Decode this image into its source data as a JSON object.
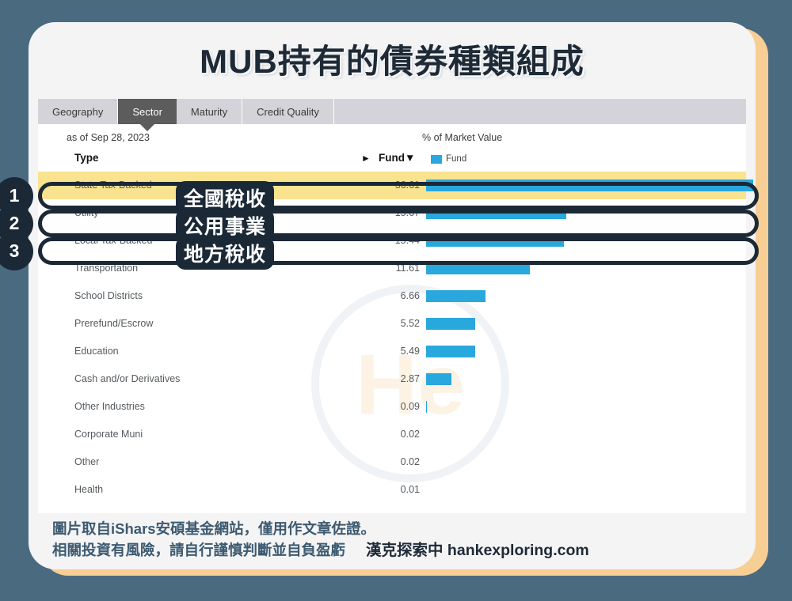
{
  "title": "MUB持有的債券種類組成",
  "colors": {
    "page_background": "#4a6a80",
    "card_background": "#f4f4f5",
    "accent_stripe": "#f7ce93",
    "bar": "#29a8dd",
    "highlight_row": "#fae38f",
    "annotation": "#1b2836",
    "active_tab": "#5c5c5c"
  },
  "tabs": [
    {
      "label": "Geography",
      "active": false
    },
    {
      "label": "Sector",
      "active": true
    },
    {
      "label": "Maturity",
      "active": false
    },
    {
      "label": "Credit Quality",
      "active": false
    }
  ],
  "meta": {
    "as_of": "as of Sep 28, 2023",
    "market_value_label": "% of Market Value"
  },
  "header": {
    "type_label": "Type",
    "expand_caret": "►",
    "fund_label": "Fund",
    "fund_sort_caret": "▼",
    "legend_label": "Fund"
  },
  "chart_data": {
    "type": "bar",
    "title": "MUB持有的債券種類組成",
    "xlabel": "% of Market Value",
    "ylabel": "Type",
    "series_name": "Fund",
    "xlim": [
      0,
      36.61
    ],
    "grid": false,
    "legend_position": "top-right",
    "categories": [
      "State Tax-Backed",
      "Utility",
      "Local Tax-Backed",
      "Transportation",
      "School Districts",
      "Prerefund/Escrow",
      "Education",
      "Cash and/or Derivatives",
      "Other Industries",
      "Corporate Muni",
      "Other",
      "Health"
    ],
    "values": [
      36.61,
      15.67,
      15.44,
      11.61,
      6.66,
      5.52,
      5.49,
      2.87,
      0.09,
      0.02,
      0.02,
      0.01
    ],
    "value_labels": [
      "36.61",
      "15.67",
      "15.44",
      "11.61",
      "6.66",
      "5.52",
      "5.49",
      "2.87",
      "0.09",
      "0.02",
      "0.02",
      "0.01"
    ]
  },
  "annotations": {
    "badges": [
      "1",
      "2",
      "3"
    ],
    "callouts": [
      "全國稅收",
      "公用事業",
      "地方稅收"
    ]
  },
  "watermark": {
    "text": "He"
  },
  "footer": {
    "line1": "圖片取自iShars安碩基金網站，僅用作文章佐證。",
    "line2": "相關投資有風險，請自行謹慎判斷並自負盈虧",
    "brand": "漢克探索中 hankexploring.com"
  }
}
